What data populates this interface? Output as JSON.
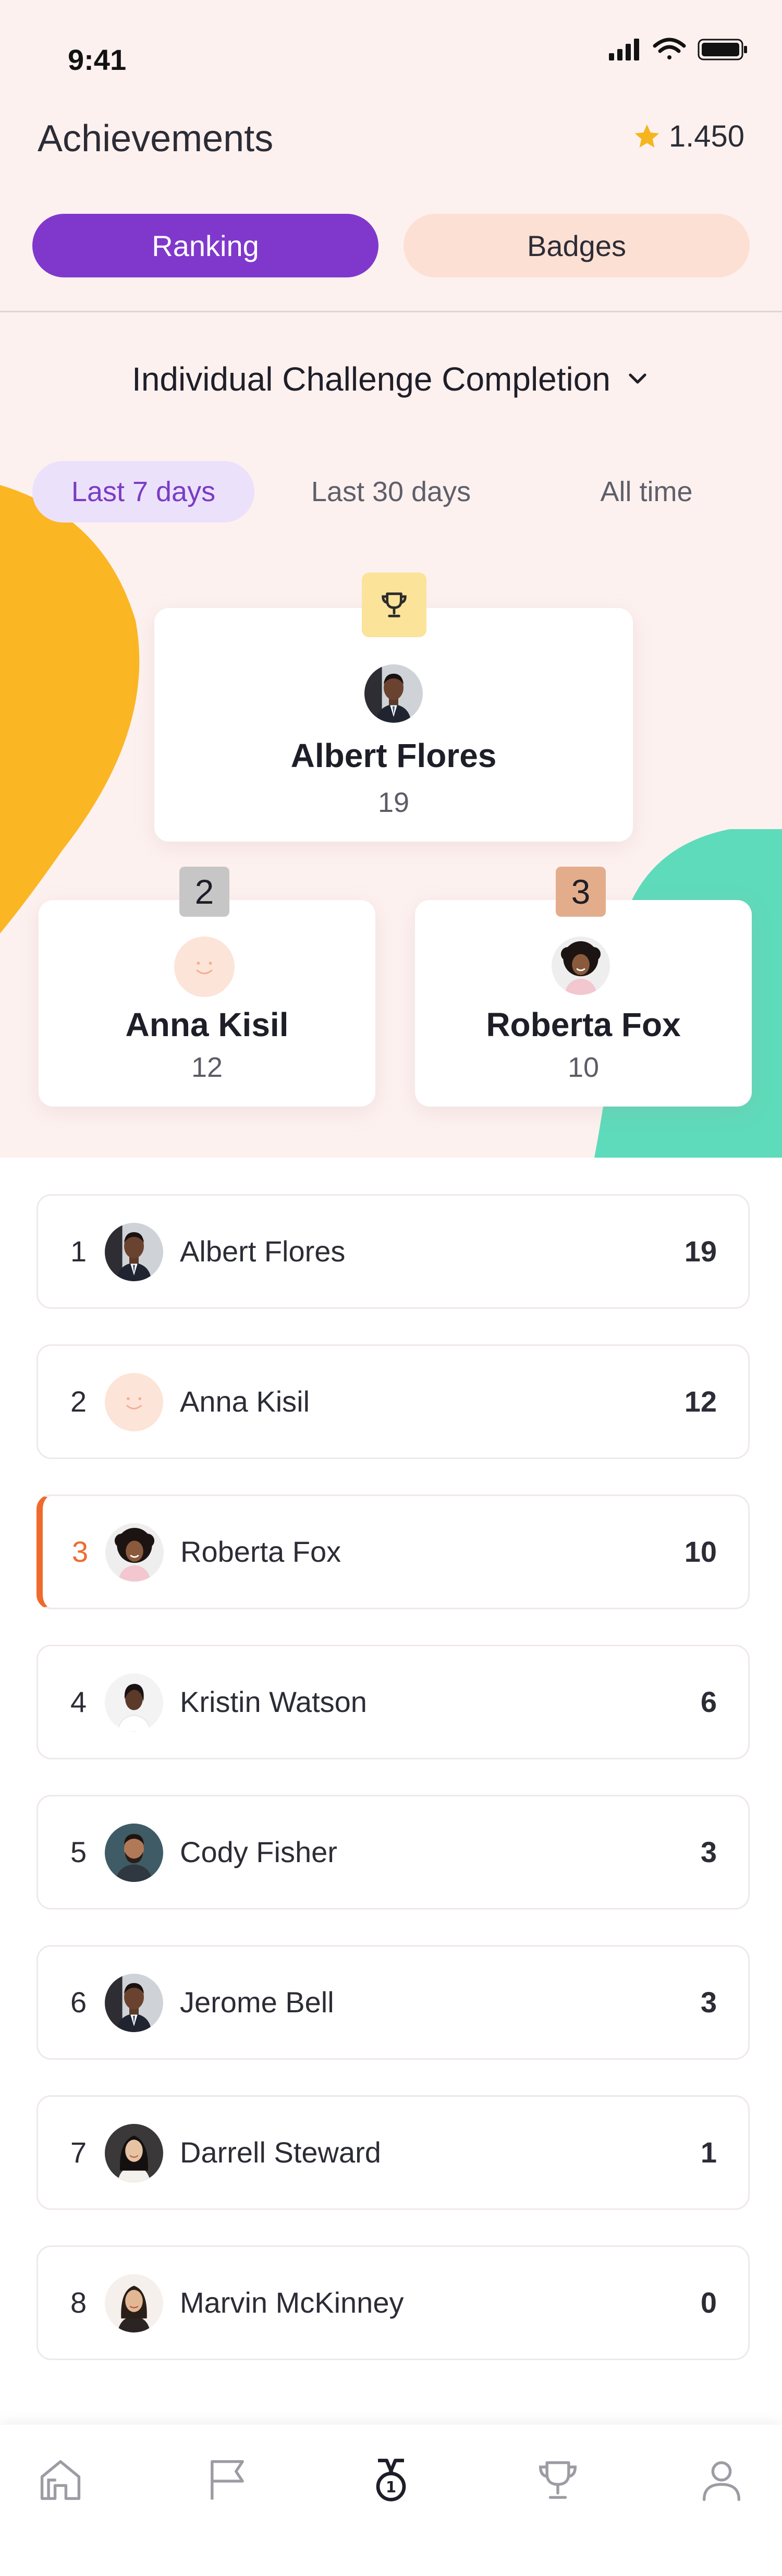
{
  "status_bar": {
    "time": "9:41"
  },
  "header": {
    "title": "Achievements",
    "points": "1.450"
  },
  "tabs": [
    {
      "label": "Ranking",
      "active": true
    },
    {
      "label": "Badges",
      "active": false
    }
  ],
  "challenge_selector": {
    "label": "Individual Challenge Completion"
  },
  "time_filters": [
    {
      "label": "Last 7 days",
      "active": true
    },
    {
      "label": "Last 30 days",
      "active": false
    },
    {
      "label": "All time",
      "active": false
    }
  ],
  "podium": {
    "first": {
      "name": "Albert Flores",
      "score": "19"
    },
    "second": {
      "rank": "2",
      "name": "Anna Kisil",
      "score": "12"
    },
    "third": {
      "rank": "3",
      "name": "Roberta Fox",
      "score": "10"
    }
  },
  "leaderboard": [
    {
      "rank": "1",
      "name": "Albert Flores",
      "score": "19"
    },
    {
      "rank": "2",
      "name": "Anna Kisil",
      "score": "12"
    },
    {
      "rank": "3",
      "name": "Roberta Fox",
      "score": "10",
      "highlighted": true
    },
    {
      "rank": "4",
      "name": "Kristin Watson",
      "score": "6"
    },
    {
      "rank": "5",
      "name": "Cody Fisher",
      "score": "3"
    },
    {
      "rank": "6",
      "name": "Jerome Bell",
      "score": "3"
    },
    {
      "rank": "7",
      "name": "Darrell Steward",
      "score": "1"
    },
    {
      "rank": "8",
      "name": "Marvin McKinney",
      "score": "0"
    }
  ],
  "bottom_nav": [
    {
      "icon": "home-icon",
      "active": false
    },
    {
      "icon": "flag-icon",
      "active": false
    },
    {
      "icon": "medal-icon",
      "active": true
    },
    {
      "icon": "trophy-icon",
      "active": false
    },
    {
      "icon": "profile-icon",
      "active": false
    }
  ],
  "colors": {
    "accent_purple": "#8038cc",
    "highlight_orange": "#ef6a2d",
    "blob_yellow": "#fbb624",
    "blob_green": "#5edbbb",
    "star": "#f6b51e"
  }
}
